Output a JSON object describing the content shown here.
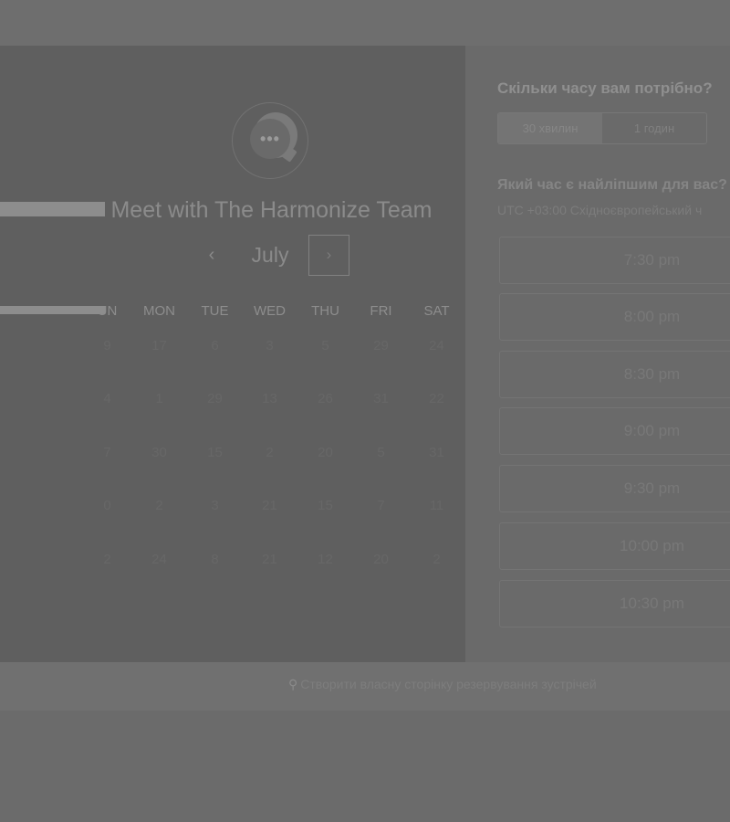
{
  "left": {
    "title": "Meet with The Harmonize Team",
    "month": {
      "prev_icon": "‹",
      "label": "July",
      "next_icon": "›"
    },
    "weekdays": [
      "UN",
      "MON",
      "TUE",
      "WED",
      "THU",
      "FRI",
      "SAT"
    ],
    "days": [
      [
        "9",
        "17",
        "6",
        "3",
        "5",
        "29",
        "24"
      ],
      [
        "4",
        "1",
        "29",
        "13",
        "26",
        "31",
        "22"
      ],
      [
        "7",
        "30",
        "15",
        "2",
        "20",
        "5",
        "31"
      ],
      [
        "0",
        "2",
        "3",
        "21",
        "15",
        "7",
        "11"
      ],
      [
        "2",
        "24",
        "8",
        "21",
        "12",
        "20",
        "2"
      ]
    ]
  },
  "right": {
    "duration_question": "Скільки часу вам потрібно?",
    "durations": [
      "30 хвилин",
      "1 годин"
    ],
    "time_question": "Який час є найліпшим для вас?",
    "timezone": "UTC +03:00 Східноєвропейський ч",
    "slots": [
      "7:30 pm",
      "8:00 pm",
      "8:30 pm",
      "9:00 pm",
      "9:30 pm",
      "10:00 pm",
      "10:30 pm"
    ]
  },
  "footer": {
    "icon": "sprocket-icon",
    "link": "Створити власну сторінку резервування зустрічей"
  },
  "colors": {
    "overlay": "#6c6c6c",
    "calendar_panel": "#5f5f5f",
    "times_panel": "#6a6a6a"
  }
}
